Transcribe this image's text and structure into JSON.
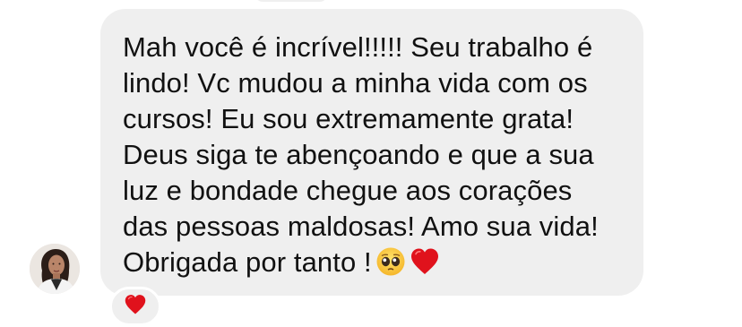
{
  "message": {
    "lines": [
      "Mah você é incrível!!!!! Seu trabalho é",
      "lindo! Vc mudou a minha vida com os",
      "cursos! Eu sou extremamente grata!",
      "Deus siga te abençoando e que a sua",
      "luz e bondade chegue aos corações",
      "das pessoas maldosas! Amo sua vida!",
      "Obrigada por tanto !"
    ],
    "emojis": [
      "pleading-face-emoji",
      "red-heart-emoji"
    ]
  },
  "sender": {
    "avatar_icon": "profile-photo"
  },
  "reaction": {
    "icon": "red-heart-emoji"
  },
  "colors": {
    "bubble": "#efefef",
    "text": "#111111",
    "heart": "#e0121c",
    "background": "#ffffff"
  }
}
